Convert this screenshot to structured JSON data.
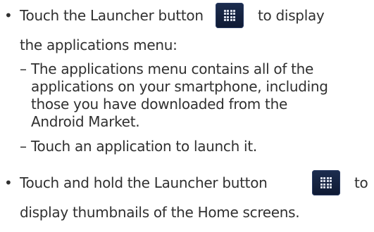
{
  "bullets": [
    {
      "symbol": "•",
      "line1_before_icon": "Touch the Launcher button",
      "icon": "launcher-grid-icon",
      "line1_after_icon": "to display",
      "line2": "the applications menu:",
      "subitems": [
        {
          "dash": "–",
          "lines": [
            "The applications menu contains all of the",
            "applications on your smartphone, including",
            "those you have downloaded from the",
            "Android Market."
          ]
        },
        {
          "dash": "–",
          "lines": [
            "Touch an application to launch it."
          ]
        }
      ]
    },
    {
      "symbol": "•",
      "line1_before_icon": "Touch and hold the Launcher button",
      "icon": "launcher-grid-icon",
      "line1_after_icon": "to",
      "line2": "display thumbnails of the Home screens."
    }
  ],
  "colors": {
    "text": "#303030",
    "icon_background": "#15233f",
    "icon_dots": "#d8dde8"
  }
}
